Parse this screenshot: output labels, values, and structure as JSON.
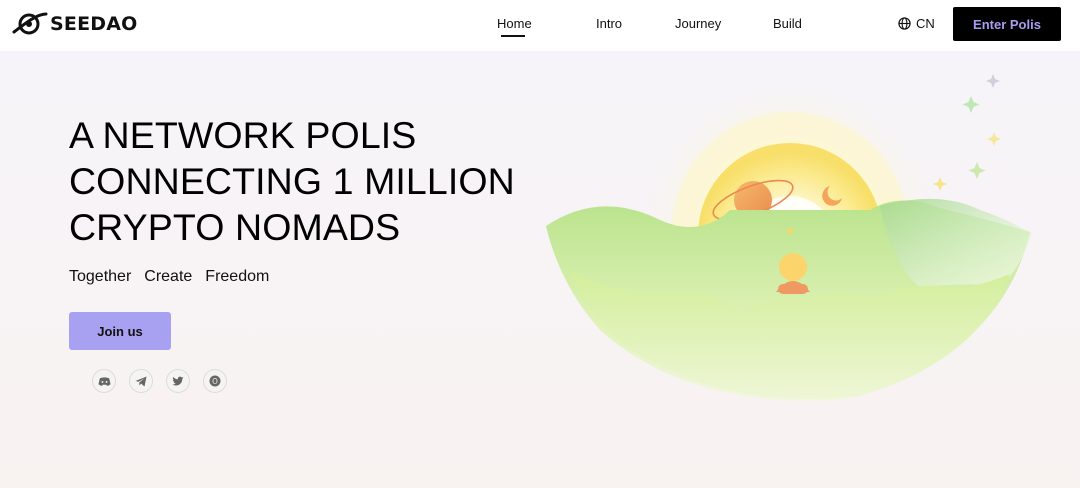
{
  "brand": {
    "name": "SEEDAO",
    "logo_icon": "planet-logo-icon"
  },
  "nav": {
    "items": [
      {
        "label": "Home",
        "active": true
      },
      {
        "label": "Intro",
        "active": false
      },
      {
        "label": "Journey",
        "active": false
      },
      {
        "label": "Build",
        "active": false
      }
    ],
    "language": {
      "icon": "globe-icon",
      "label": "CN"
    },
    "enter_button": "Enter Polis"
  },
  "hero": {
    "title_lines": [
      "A NETWORK POLIS",
      "CONNECTING 1 MILLION",
      "CRYPTO NOMADS"
    ],
    "tagline": [
      "Together",
      "Create",
      "Freedom"
    ],
    "join_button": "Join us"
  },
  "socials": [
    {
      "icon": "discord-icon"
    },
    {
      "icon": "telegram-icon"
    },
    {
      "icon": "twitter-icon"
    },
    {
      "icon": "mirror-icon"
    }
  ],
  "colors": {
    "accent": "#a8a1f2",
    "enter_text": "#a99cf1",
    "header_bg": "#ffffff",
    "page_bg": "#f7f4f7"
  }
}
